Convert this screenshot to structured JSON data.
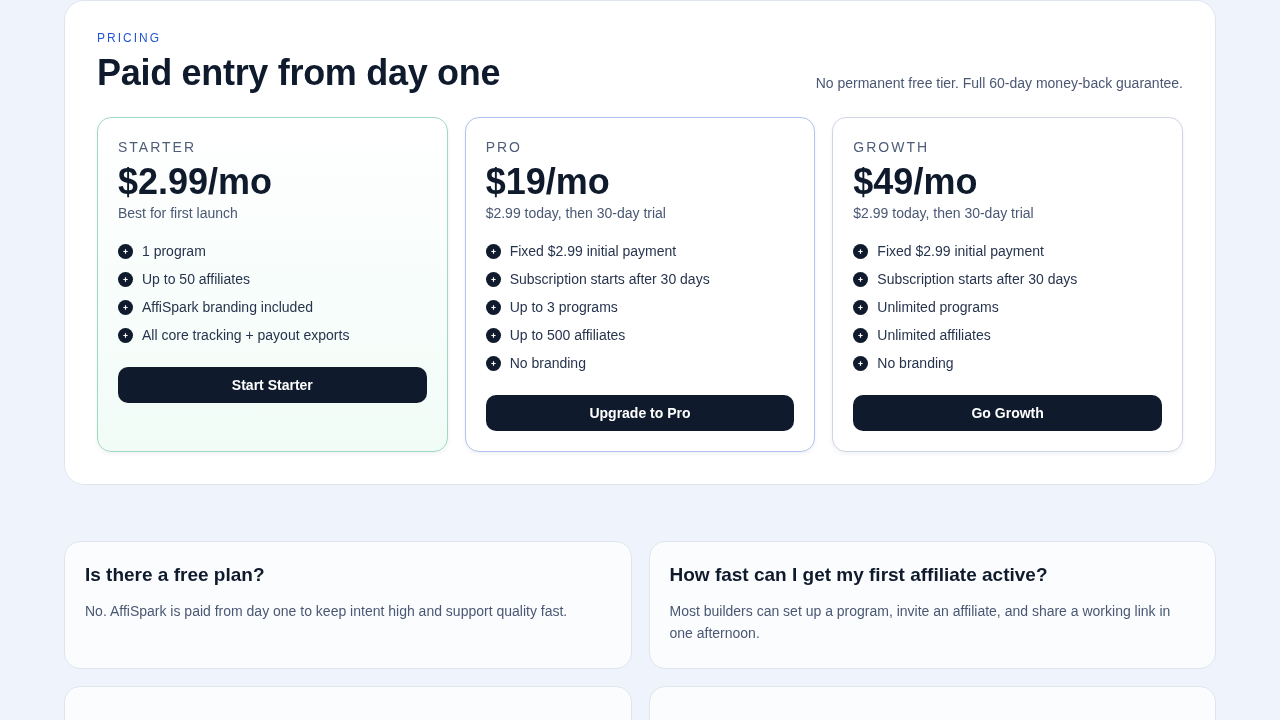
{
  "pricing": {
    "eyebrow": "PRICING",
    "title": "Paid entry from day one",
    "note": "No permanent free tier. Full 60-day money-back guarantee.",
    "plans": [
      {
        "name": "STARTER",
        "price": "$2.99/mo",
        "subtitle": "Best for first launch",
        "color": "#9fd8c8",
        "featured": true,
        "features": [
          "1 program",
          "Up to 50 affiliates",
          "AffiSpark branding included",
          "All core tracking + payout exports"
        ],
        "button": "Start Starter"
      },
      {
        "name": "PRO",
        "price": "$19/mo",
        "subtitle": "$2.99 today, then 30-day trial",
        "color": "#b3c2ee",
        "featured": false,
        "features": [
          "Fixed $2.99 initial payment",
          "Subscription starts after 30 days",
          "Up to 3 programs",
          "Up to 500 affiliates",
          "No branding"
        ],
        "button": "Upgrade to Pro"
      },
      {
        "name": "GROWTH",
        "price": "$49/mo",
        "subtitle": "$2.99 today, then 30-day trial",
        "color": "#cfd6e3",
        "featured": false,
        "features": [
          "Fixed $2.99 initial payment",
          "Subscription starts after 30 days",
          "Unlimited programs",
          "Unlimited affiliates",
          "No branding"
        ],
        "button": "Go Growth"
      }
    ]
  },
  "faq": [
    {
      "kind": "full",
      "question": "Is there a free plan?",
      "answer": "No. AffiSpark is paid from day one to keep intent high and support quality fast."
    },
    {
      "kind": "full",
      "question": "How fast can I get my first affiliate active?",
      "answer": "Most builders can set up a program, invite an affiliate, and share a working link in one afternoon."
    },
    {
      "kind": "cut"
    },
    {
      "kind": "cut"
    }
  ]
}
